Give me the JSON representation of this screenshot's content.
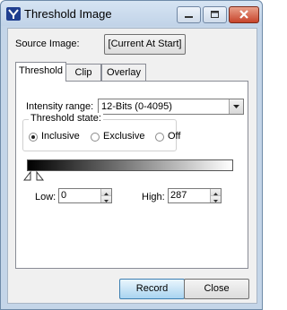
{
  "window": {
    "title": "Threshold Image"
  },
  "source": {
    "label": "Source Image:",
    "button_label": "[Current At Start]"
  },
  "tabs": [
    {
      "label": "Threshold",
      "active": true
    },
    {
      "label": "Clip",
      "active": false
    },
    {
      "label": "Overlay",
      "active": false
    }
  ],
  "intensity": {
    "label": "Intensity range:",
    "selected": "12-Bits (0-4095)"
  },
  "threshold_state": {
    "legend": "Threshold state:",
    "options": [
      {
        "label": "Inclusive",
        "selected": true
      },
      {
        "label": "Exclusive",
        "selected": false
      },
      {
        "label": "Off",
        "selected": false
      }
    ]
  },
  "range": {
    "low_label": "Low:",
    "low_value": "0",
    "high_label": "High:",
    "high_value": "287"
  },
  "footer": {
    "record_label": "Record",
    "close_label": "Close"
  },
  "colors": {
    "titlebar": "#c4d5e8",
    "close_button": "#c7442b",
    "default_button": "#a9d4f0"
  }
}
